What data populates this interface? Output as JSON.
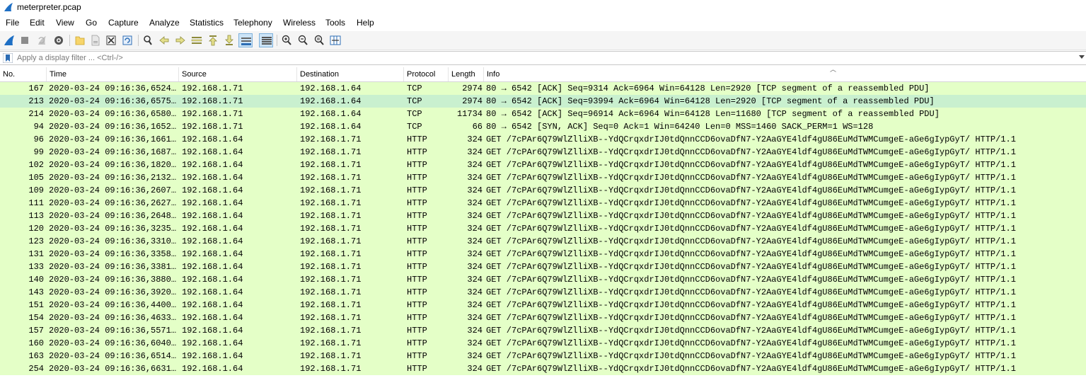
{
  "window": {
    "title": "meterpreter.pcap",
    "icon": "shark-fin-icon"
  },
  "menu": [
    "File",
    "Edit",
    "View",
    "Go",
    "Capture",
    "Analyze",
    "Statistics",
    "Telephony",
    "Wireless",
    "Tools",
    "Help"
  ],
  "toolbar": {
    "buttons": [
      "start-capture",
      "stop-capture",
      "restart-capture",
      "capture-options",
      "open-file",
      "save-file",
      "close-file",
      "reload-file",
      "find-packet",
      "go-back",
      "go-forward",
      "go-to-packet",
      "go-first",
      "go-last",
      "auto-scroll",
      "colorize",
      "zoom-in",
      "zoom-out",
      "zoom-normal",
      "resize-columns"
    ],
    "active": [
      "auto-scroll",
      "colorize"
    ]
  },
  "filter": {
    "placeholder": "Apply a display filter ... <Ctrl-/>",
    "value": ""
  },
  "columns": {
    "no": "No.",
    "time": "Time",
    "source": "Source",
    "destination": "Destination",
    "protocol": "Protocol",
    "length": "Length",
    "info": "Info"
  },
  "colors": {
    "row_bg": "#e4ffc7",
    "selected_bg": "#c9f0cf"
  },
  "packets": [
    {
      "no": "167",
      "time": "2020-03-24 09:16:36,6524…",
      "src": "192.168.1.71",
      "dst": "192.168.1.64",
      "proto": "TCP",
      "len": "2974",
      "info": "80 → 6542 [ACK] Seq=9314 Ack=6964 Win=64128 Len=2920 [TCP segment of a reassembled PDU]",
      "selected": false
    },
    {
      "no": "213",
      "time": "2020-03-24 09:16:36,6575…",
      "src": "192.168.1.71",
      "dst": "192.168.1.64",
      "proto": "TCP",
      "len": "2974",
      "info": "80 → 6542 [ACK] Seq=93994 Ack=6964 Win=64128 Len=2920 [TCP segment of a reassembled PDU]",
      "selected": true
    },
    {
      "no": "214",
      "time": "2020-03-24 09:16:36,6580…",
      "src": "192.168.1.71",
      "dst": "192.168.1.64",
      "proto": "TCP",
      "len": "11734",
      "info": "80 → 6542 [ACK] Seq=96914 Ack=6964 Win=64128 Len=11680 [TCP segment of a reassembled PDU]",
      "selected": false
    },
    {
      "no": "94",
      "time": "2020-03-24 09:16:36,1652…",
      "src": "192.168.1.71",
      "dst": "192.168.1.64",
      "proto": "TCP",
      "len": "66",
      "info": "80 → 6542 [SYN, ACK] Seq=0 Ack=1 Win=64240 Len=0 MSS=1460 SACK_PERM=1 WS=128",
      "selected": false
    },
    {
      "no": "96",
      "time": "2020-03-24 09:16:36,1661…",
      "src": "192.168.1.64",
      "dst": "192.168.1.71",
      "proto": "HTTP",
      "len": "324",
      "info": "GET /7cPAr6Q79WlZlliXB--YdQCrqxdrIJ0tdQnnCCD6ovaDfN7-Y2AaGYE4ldf4gU86EuMdTWMCumgeE-aGe6gIypGyT/ HTTP/1.1",
      "selected": false
    },
    {
      "no": "99",
      "time": "2020-03-24 09:16:36,1687…",
      "src": "192.168.1.64",
      "dst": "192.168.1.71",
      "proto": "HTTP",
      "len": "324",
      "info": "GET /7cPAr6Q79WlZlliXB--YdQCrqxdrIJ0tdQnnCCD6ovaDfN7-Y2AaGYE4ldf4gU86EuMdTWMCumgeE-aGe6gIypGyT/ HTTP/1.1",
      "selected": false
    },
    {
      "no": "102",
      "time": "2020-03-24 09:16:36,1820…",
      "src": "192.168.1.64",
      "dst": "192.168.1.71",
      "proto": "HTTP",
      "len": "324",
      "info": "GET /7cPAr6Q79WlZlliXB--YdQCrqxdrIJ0tdQnnCCD6ovaDfN7-Y2AaGYE4ldf4gU86EuMdTWMCumgeE-aGe6gIypGyT/ HTTP/1.1",
      "selected": false
    },
    {
      "no": "105",
      "time": "2020-03-24 09:16:36,2132…",
      "src": "192.168.1.64",
      "dst": "192.168.1.71",
      "proto": "HTTP",
      "len": "324",
      "info": "GET /7cPAr6Q79WlZlliXB--YdQCrqxdrIJ0tdQnnCCD6ovaDfN7-Y2AaGYE4ldf4gU86EuMdTWMCumgeE-aGe6gIypGyT/ HTTP/1.1",
      "selected": false
    },
    {
      "no": "109",
      "time": "2020-03-24 09:16:36,2607…",
      "src": "192.168.1.64",
      "dst": "192.168.1.71",
      "proto": "HTTP",
      "len": "324",
      "info": "GET /7cPAr6Q79WlZlliXB--YdQCrqxdrIJ0tdQnnCCD6ovaDfN7-Y2AaGYE4ldf4gU86EuMdTWMCumgeE-aGe6gIypGyT/ HTTP/1.1",
      "selected": false
    },
    {
      "no": "111",
      "time": "2020-03-24 09:16:36,2627…",
      "src": "192.168.1.64",
      "dst": "192.168.1.71",
      "proto": "HTTP",
      "len": "324",
      "info": "GET /7cPAr6Q79WlZlliXB--YdQCrqxdrIJ0tdQnnCCD6ovaDfN7-Y2AaGYE4ldf4gU86EuMdTWMCumgeE-aGe6gIypGyT/ HTTP/1.1",
      "selected": false
    },
    {
      "no": "113",
      "time": "2020-03-24 09:16:36,2648…",
      "src": "192.168.1.64",
      "dst": "192.168.1.71",
      "proto": "HTTP",
      "len": "324",
      "info": "GET /7cPAr6Q79WlZlliXB--YdQCrqxdrIJ0tdQnnCCD6ovaDfN7-Y2AaGYE4ldf4gU86EuMdTWMCumgeE-aGe6gIypGyT/ HTTP/1.1",
      "selected": false
    },
    {
      "no": "120",
      "time": "2020-03-24 09:16:36,3235…",
      "src": "192.168.1.64",
      "dst": "192.168.1.71",
      "proto": "HTTP",
      "len": "324",
      "info": "GET /7cPAr6Q79WlZlliXB--YdQCrqxdrIJ0tdQnnCCD6ovaDfN7-Y2AaGYE4ldf4gU86EuMdTWMCumgeE-aGe6gIypGyT/ HTTP/1.1",
      "selected": false
    },
    {
      "no": "123",
      "time": "2020-03-24 09:16:36,3310…",
      "src": "192.168.1.64",
      "dst": "192.168.1.71",
      "proto": "HTTP",
      "len": "324",
      "info": "GET /7cPAr6Q79WlZlliXB--YdQCrqxdrIJ0tdQnnCCD6ovaDfN7-Y2AaGYE4ldf4gU86EuMdTWMCumgeE-aGe6gIypGyT/ HTTP/1.1",
      "selected": false
    },
    {
      "no": "131",
      "time": "2020-03-24 09:16:36,3358…",
      "src": "192.168.1.64",
      "dst": "192.168.1.71",
      "proto": "HTTP",
      "len": "324",
      "info": "GET /7cPAr6Q79WlZlliXB--YdQCrqxdrIJ0tdQnnCCD6ovaDfN7-Y2AaGYE4ldf4gU86EuMdTWMCumgeE-aGe6gIypGyT/ HTTP/1.1",
      "selected": false
    },
    {
      "no": "133",
      "time": "2020-03-24 09:16:36,3381…",
      "src": "192.168.1.64",
      "dst": "192.168.1.71",
      "proto": "HTTP",
      "len": "324",
      "info": "GET /7cPAr6Q79WlZlliXB--YdQCrqxdrIJ0tdQnnCCD6ovaDfN7-Y2AaGYE4ldf4gU86EuMdTWMCumgeE-aGe6gIypGyT/ HTTP/1.1",
      "selected": false
    },
    {
      "no": "140",
      "time": "2020-03-24 09:16:36,3880…",
      "src": "192.168.1.64",
      "dst": "192.168.1.71",
      "proto": "HTTP",
      "len": "324",
      "info": "GET /7cPAr6Q79WlZlliXB--YdQCrqxdrIJ0tdQnnCCD6ovaDfN7-Y2AaGYE4ldf4gU86EuMdTWMCumgeE-aGe6gIypGyT/ HTTP/1.1",
      "selected": false
    },
    {
      "no": "143",
      "time": "2020-03-24 09:16:36,3920…",
      "src": "192.168.1.64",
      "dst": "192.168.1.71",
      "proto": "HTTP",
      "len": "324",
      "info": "GET /7cPAr6Q79WlZlliXB--YdQCrqxdrIJ0tdQnnCCD6ovaDfN7-Y2AaGYE4ldf4gU86EuMdTWMCumgeE-aGe6gIypGyT/ HTTP/1.1",
      "selected": false
    },
    {
      "no": "151",
      "time": "2020-03-24 09:16:36,4400…",
      "src": "192.168.1.64",
      "dst": "192.168.1.71",
      "proto": "HTTP",
      "len": "324",
      "info": "GET /7cPAr6Q79WlZlliXB--YdQCrqxdrIJ0tdQnnCCD6ovaDfN7-Y2AaGYE4ldf4gU86EuMdTWMCumgeE-aGe6gIypGyT/ HTTP/1.1",
      "selected": false
    },
    {
      "no": "154",
      "time": "2020-03-24 09:16:36,4633…",
      "src": "192.168.1.64",
      "dst": "192.168.1.71",
      "proto": "HTTP",
      "len": "324",
      "info": "GET /7cPAr6Q79WlZlliXB--YdQCrqxdrIJ0tdQnnCCD6ovaDfN7-Y2AaGYE4ldf4gU86EuMdTWMCumgeE-aGe6gIypGyT/ HTTP/1.1",
      "selected": false
    },
    {
      "no": "157",
      "time": "2020-03-24 09:16:36,5571…",
      "src": "192.168.1.64",
      "dst": "192.168.1.71",
      "proto": "HTTP",
      "len": "324",
      "info": "GET /7cPAr6Q79WlZlliXB--YdQCrqxdrIJ0tdQnnCCD6ovaDfN7-Y2AaGYE4ldf4gU86EuMdTWMCumgeE-aGe6gIypGyT/ HTTP/1.1",
      "selected": false
    },
    {
      "no": "160",
      "time": "2020-03-24 09:16:36,6040…",
      "src": "192.168.1.64",
      "dst": "192.168.1.71",
      "proto": "HTTP",
      "len": "324",
      "info": "GET /7cPAr6Q79WlZlliXB--YdQCrqxdrIJ0tdQnnCCD6ovaDfN7-Y2AaGYE4ldf4gU86EuMdTWMCumgeE-aGe6gIypGyT/ HTTP/1.1",
      "selected": false
    },
    {
      "no": "163",
      "time": "2020-03-24 09:16:36,6514…",
      "src": "192.168.1.64",
      "dst": "192.168.1.71",
      "proto": "HTTP",
      "len": "324",
      "info": "GET /7cPAr6Q79WlZlliXB--YdQCrqxdrIJ0tdQnnCCD6ovaDfN7-Y2AaGYE4ldf4gU86EuMdTWMCumgeE-aGe6gIypGyT/ HTTP/1.1",
      "selected": false
    },
    {
      "no": "254",
      "time": "2020-03-24 09:16:36,6631…",
      "src": "192.168.1.64",
      "dst": "192.168.1.71",
      "proto": "HTTP",
      "len": "324",
      "info": "GET /7cPAr6Q79WlZlliXB--YdQCrqxdrIJ0tdQnnCCD6ovaDfN7-Y2AaGYE4ldf4gU86EuMdTWMCumgeE-aGe6gIypGyT/ HTTP/1.1",
      "selected": false
    }
  ]
}
